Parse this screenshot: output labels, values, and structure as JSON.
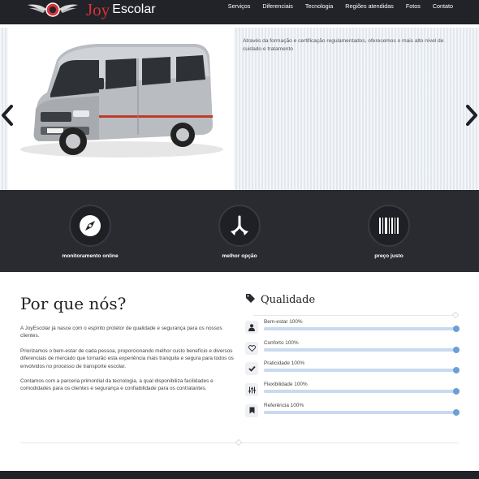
{
  "brand": {
    "joy": "Joy",
    "escolar": "Escolar"
  },
  "nav": [
    "Serviços",
    "Diferenciais",
    "Tecnologia",
    "Regiões atendidas",
    "Fotos",
    "Contato"
  ],
  "hero": {
    "caption": "Através da formação e certificação regulamentados, oferecemos o mais alto nível de cuidado e tratamento",
    "van_plate_text": "Marado"
  },
  "features": [
    {
      "label": "monitoramento online",
      "icon": "compass-icon"
    },
    {
      "label": "melhor opção",
      "icon": "split-arrows-icon"
    },
    {
      "label": "preço justo",
      "icon": "barcode-icon"
    }
  ],
  "why": {
    "title": "Por que nós?",
    "paragraphs": [
      "A JoyEscolar já nasce com o espírito protetor de qualidade e segurança para os nossos clientes.",
      "Priorizamos o bem-estar de cada pessoa, proporcionando melhor custo benefício e diversos diferenciais de mercado que tornarão esta experiência mais tranquila e segura para todos os envolvidos no processo de transporte escolar.",
      "Contamos com a parceria primordial da tecnologia, a qual disponibiliza facilidades e comodidades para os clientes e segurança e confiabilidade para os contratantes."
    ]
  },
  "quality": {
    "title": "Qualidade",
    "skills": [
      {
        "label": "Bem-estar 100%",
        "percent": 100,
        "icon": "person-icon"
      },
      {
        "label": "Conforto 100%",
        "percent": 100,
        "icon": "heart-icon"
      },
      {
        "label": "Praticidade 100%",
        "percent": 100,
        "icon": "check-icon"
      },
      {
        "label": "Flexibilidade 100%",
        "percent": 100,
        "icon": "sliders-icon"
      },
      {
        "label": "Referência 100%",
        "percent": 100,
        "icon": "bookmark-icon"
      }
    ]
  },
  "colors": {
    "brand_red": "#d6333a",
    "dark": "#222329",
    "bar": "#c8daf0",
    "knob": "#6d9fd6"
  }
}
